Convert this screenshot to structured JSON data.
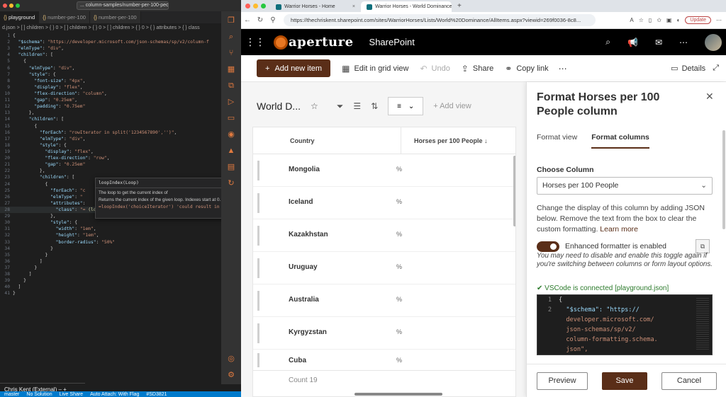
{
  "vscode": {
    "command_center": "... column-samples/number-per-100-people",
    "tabs": [
      {
        "label": "playground",
        "active": true
      },
      {
        "label": "number-per-100",
        "active": false
      },
      {
        "label": "number-per-100",
        "active": false
      }
    ],
    "breadcrumb": "d.json > [ ] children > { } 0 > [ ] children > { } 0 > [ ] children > { } 0 > { } attributes > { } class",
    "hover": {
      "signature": "loopIndex(Loop)",
      "line1": "The loop to get the current index of",
      "line2": "Returns the current index of the given loop. Indexes start at 0."
    },
    "hover_overlay_line": "=loopIndex('choiceIterator') 'could result in 0'",
    "terminal_tab": "Chris Kent (External)",
    "status": [
      "master",
      "No Solution",
      "Live Share",
      "Auto Attach: With Flag",
      "#SD3821"
    ]
  },
  "browser": {
    "tabs": [
      {
        "label": "Warrior Horses - Home",
        "active": false
      },
      {
        "label": "Warrior Horses - World Dominance",
        "active": true
      }
    ],
    "url": "https://thechriskent.sharepoint.com/sites/WarriorHorses/Lists/World%20Dominance/AllItems.aspx?viewid=269f0036-8c8...",
    "update_label": "Update"
  },
  "sharepoint": {
    "logo_text": "aperture",
    "app_name": "SharePoint",
    "commands": {
      "add_new_item": "Add new item",
      "edit_grid": "Edit in grid view",
      "undo": "Undo",
      "share": "Share",
      "copy_link": "Copy link",
      "details": "Details"
    },
    "list": {
      "title": "World D...",
      "add_view": "Add view",
      "col_country": "Country",
      "col_horses": "Horses per 100 People",
      "rows": [
        {
          "country": "Mongolia",
          "value": "%"
        },
        {
          "country": "Iceland",
          "value": "%"
        },
        {
          "country": "Kazakhstan",
          "value": "%"
        },
        {
          "country": "Uruguay",
          "value": "%"
        },
        {
          "country": "Australia",
          "value": "%"
        },
        {
          "country": "Kyrgyzstan",
          "value": "%"
        },
        {
          "country": "Cuba",
          "value": "%"
        }
      ],
      "count": "Count 19"
    },
    "panel": {
      "title": "Format Horses per 100 People column",
      "tab_view": "Format view",
      "tab_columns": "Format columns",
      "choose_label": "Choose Column",
      "choose_value": "Horses per 100 People",
      "description": "Change the display of this column by adding JSON below. Remove the text from the box to clear the custom formatting.",
      "learn_more": "Learn more",
      "toggle_label": "Enhanced formatter is enabled",
      "toggle_note": "You may need to disable and enable this toggle again if you're switching between columns or form layout options.",
      "vscode_status": "✔ VSCode is connected [playground.json]",
      "json_lines": [
        {
          "n": "1",
          "t": "{"
        },
        {
          "n": "2",
          "t": "  \"$schema\": \"https://"
        },
        {
          "n": "",
          "t": "  developer.microsoft.com/"
        },
        {
          "n": "",
          "t": "  json-schemas/sp/v2/"
        },
        {
          "n": "",
          "t": "  column-formatting.schema."
        },
        {
          "n": "",
          "t": "  json\","
        }
      ],
      "preview": "Preview",
      "save": "Save",
      "cancel": "Cancel"
    }
  }
}
